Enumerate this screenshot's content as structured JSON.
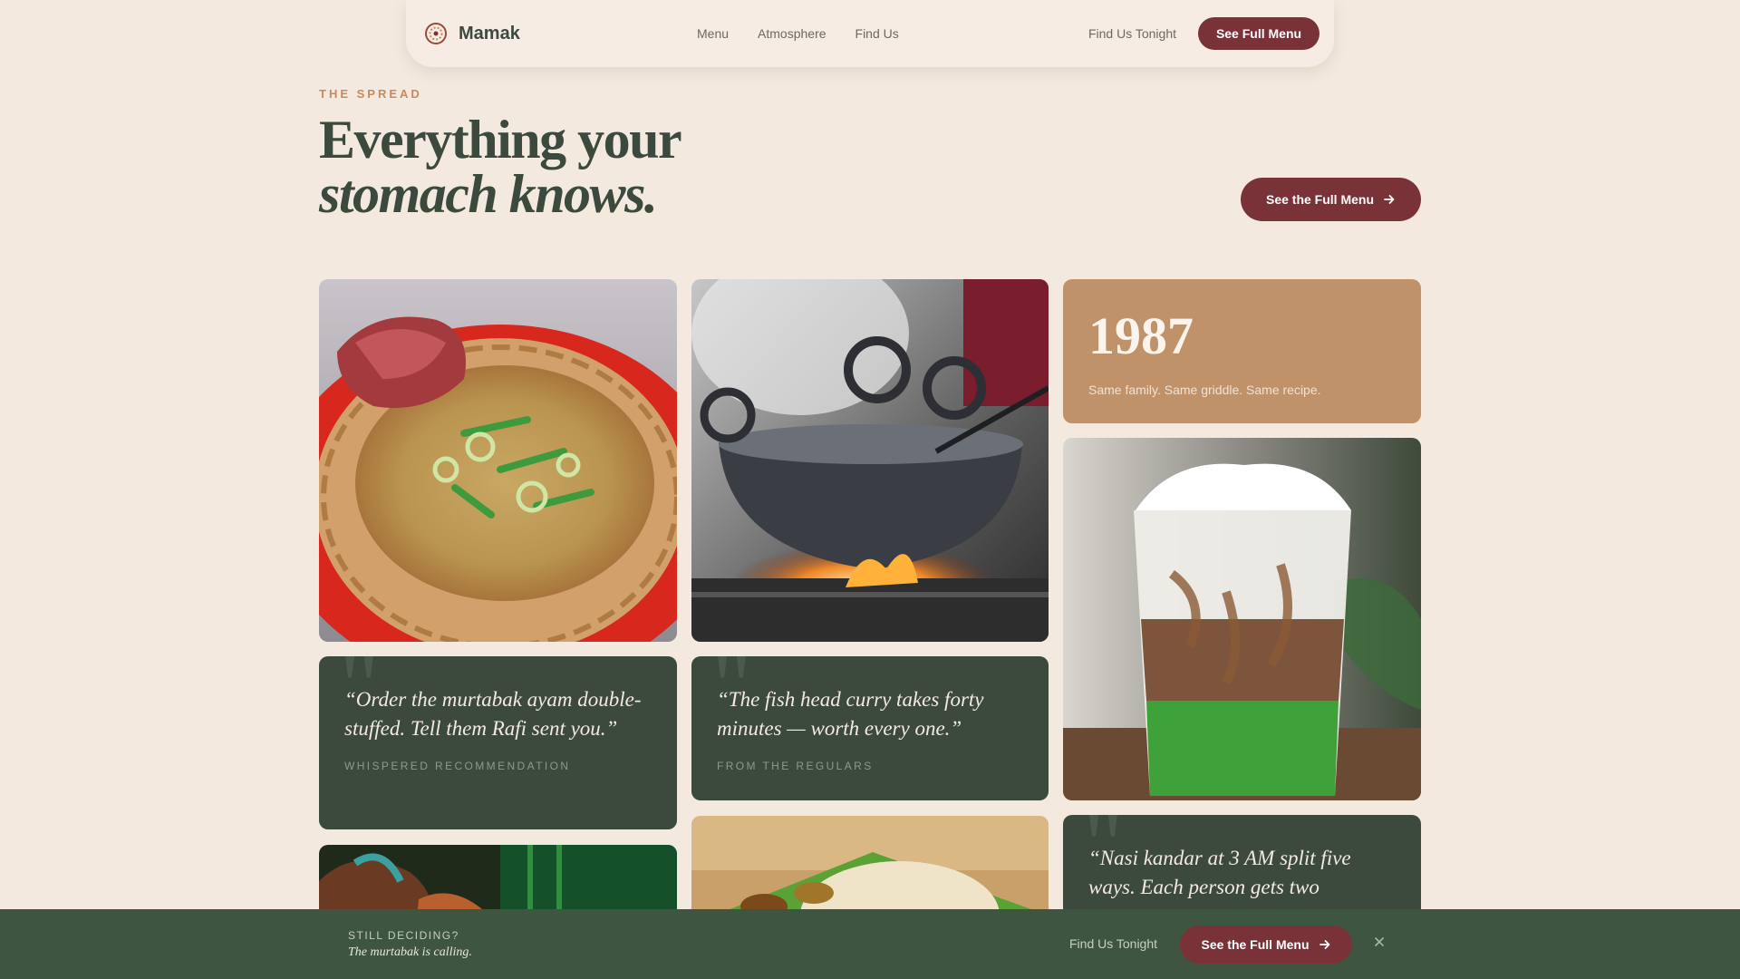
{
  "nav": {
    "brand": "Mamak",
    "links": [
      "Menu",
      "Atmosphere",
      "Find Us"
    ],
    "find_tonight": "Find Us Tonight",
    "cta": "See Full Menu"
  },
  "hero": {
    "eyebrow": "THE SPREAD",
    "headline_line1": "Everything your",
    "headline_line2": "stomach knows.",
    "cta": "See the Full Menu"
  },
  "gallery": {
    "stat": {
      "year": "1987",
      "caption": "Same family. Same griddle. Same recipe."
    },
    "quotes": [
      {
        "text": "“Order the murtabak ayam double-stuffed. Tell them Rafi sent you.”",
        "caption": "WHISPERED RECOMMENDATION"
      },
      {
        "text": "“The fish head curry takes forty minutes — worth every one.”",
        "caption": "FROM THE REGULARS"
      },
      {
        "text": "“Nasi kandar at 3 AM split five ways. Each person gets two",
        "caption": ""
      }
    ],
    "images": [
      "roti-canai-curry-photo",
      "wok-over-flame-photo",
      "cendol-drink-photo",
      "tandoori-chicken-photo",
      "roti-tissue-banana-leaf-photo"
    ]
  },
  "sticky_bar": {
    "eyebrow": "STILL DECIDING?",
    "tagline": "The murtabak is calling.",
    "find_tonight": "Find Us Tonight",
    "cta": "See the Full Menu",
    "close_icon": "close-icon"
  },
  "colors": {
    "background": "#f4e9df",
    "forest": "#3b4a3c",
    "maroon": "#7a3239",
    "caramel": "#c0926a",
    "accent_eyebrow": "#c58a5f"
  }
}
